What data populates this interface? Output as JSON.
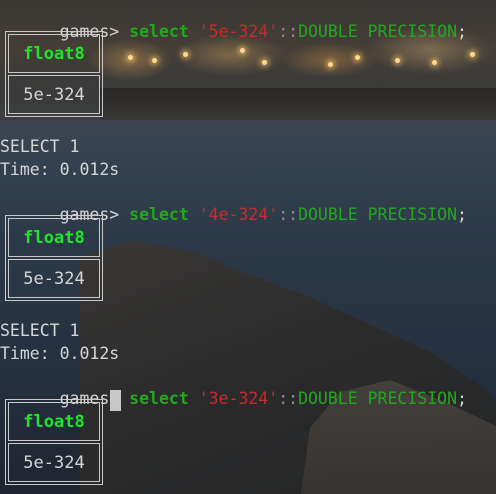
{
  "terminal": {
    "blocks": [
      {
        "prompt": "games> ",
        "kw": "select",
        "literal": "'5e-324'",
        "cast": "::",
        "type": "DOUBLE PRECISION",
        "end": ";",
        "header": "float8",
        "value": "5e-324",
        "status": "SELECT 1",
        "time": "Time: 0.012s"
      },
      {
        "prompt": "games> ",
        "kw": "select",
        "literal": "'4e-324'",
        "cast": "::",
        "type": "DOUBLE PRECISION",
        "end": ";",
        "header": "float8",
        "value": "5e-324",
        "status": "SELECT 1",
        "time": "Time: 0.012s"
      },
      {
        "prompt": "games> ",
        "kw": "select",
        "literal": "'3e-324'",
        "cast": "::",
        "type": "DOUBLE PRECISION",
        "end": ";",
        "header": "float8",
        "value": "5e-324"
      }
    ]
  },
  "colors": {
    "keyword": "#23a81d",
    "string_literal": "#c72b2b",
    "column_header": "#1ee62a",
    "text": "#d6d6d6"
  }
}
